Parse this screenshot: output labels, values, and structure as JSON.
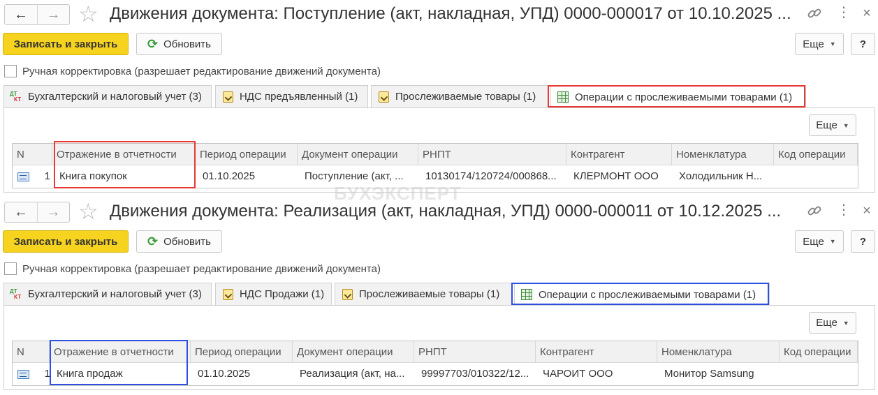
{
  "windows": [
    {
      "title": "Движения документа: Поступление (акт, накладная, УПД) 0000-000017 от 10.10.2025 ...",
      "toolbar": {
        "save_close": "Записать и закрыть",
        "refresh": "Обновить",
        "more": "Еще",
        "help": "?"
      },
      "checkbox_label": "Ручная корректировка (разрешает редактирование движений документа)",
      "tabs": [
        {
          "label": "Бухгалтерский и налоговый учет (3)",
          "icon": "dt-kt-icon"
        },
        {
          "label": "НДС предъявленный (1)",
          "icon": "document-icon"
        },
        {
          "label": "Прослеживаемые товары (1)",
          "icon": "document-icon"
        },
        {
          "label": "Операции с прослеживаемыми товарами (1)",
          "icon": "grid-icon",
          "active": true
        }
      ],
      "panel_more": "Еще",
      "columns": [
        "N",
        "Отражение в отчетности",
        "Период операции",
        "Документ операции",
        "РНПТ",
        "Контрагент",
        "Номенклатура",
        "Код операции"
      ],
      "rows": [
        {
          "n": "1",
          "reflection": "Книга покупок",
          "period": "01.10.2025",
          "document": "Поступление (акт, ...",
          "rnpt": "10130174/120724/000868...",
          "counterparty": "КЛЕРМОНТ ООО",
          "item": "Холодильник Н...",
          "code": ""
        }
      ]
    },
    {
      "title": "Движения документа: Реализация (акт, накладная, УПД) 0000-000011 от 10.12.2025 ...",
      "toolbar": {
        "save_close": "Записать и закрыть",
        "refresh": "Обновить",
        "more": "Еще",
        "help": "?"
      },
      "checkbox_label": "Ручная корректировка (разрешает редактирование движений документа)",
      "tabs": [
        {
          "label": "Бухгалтерский и налоговый учет (3)",
          "icon": "dt-kt-icon"
        },
        {
          "label": "НДС Продажи (1)",
          "icon": "document-icon"
        },
        {
          "label": "Прослеживаемые товары (1)",
          "icon": "document-icon"
        },
        {
          "label": "Операции с прослеживаемыми товарами (1)",
          "icon": "grid-icon",
          "active": true
        }
      ],
      "panel_more": "Еще",
      "columns": [
        "N",
        "Отражение в отчетности",
        "Период операции",
        "Документ операции",
        "РНПТ",
        "Контрагент",
        "Номенклатура",
        "Код операции"
      ],
      "rows": [
        {
          "n": "1",
          "reflection": "Книга продаж",
          "period": "01.10.2025",
          "document": "Реализация (акт, на...",
          "rnpt": "99997703/010322/12...",
          "counterparty": "ЧАРОИТ ООО",
          "item": "Монитор Samsung",
          "code": ""
        }
      ]
    }
  ],
  "watermark": "БУХЭКСПЕРТ",
  "colors": {
    "primary_button": "#f6d31e",
    "highlight_red": "#e53935",
    "highlight_blue": "#2f4fe0"
  }
}
